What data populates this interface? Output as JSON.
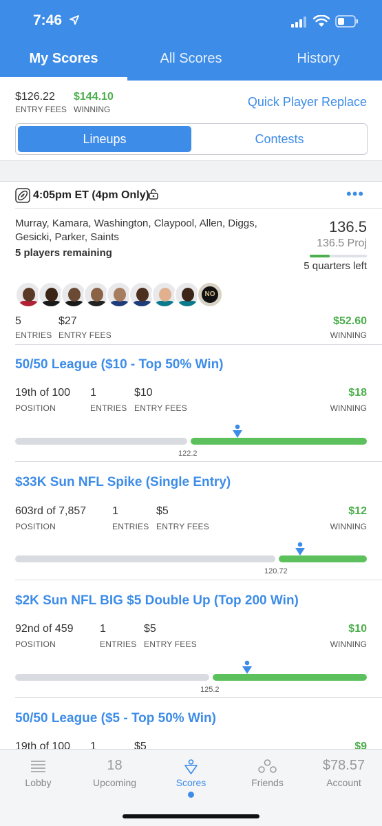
{
  "status": {
    "time": "7:46"
  },
  "tabs": [
    {
      "label": "My Scores",
      "active": true
    },
    {
      "label": "All Scores",
      "active": false
    },
    {
      "label": "History",
      "active": false
    }
  ],
  "summary": {
    "entry_fees_value": "$126.22",
    "entry_fees_label": "ENTRY FEES",
    "winning_value": "$144.10",
    "winning_label": "WINNING",
    "quick_replace": "Quick Player Replace"
  },
  "segment": {
    "lineups": "Lineups",
    "contests": "Contests"
  },
  "lineup": {
    "title": "4:05pm ET (4pm Only)",
    "players": "Murray, Kamara, Washington, Claypool, Allen, Diggs, Gesicki, Parker, Saints",
    "remaining": "5 players remaining",
    "points": "136.5",
    "projection": "136.5 Proj",
    "progress": 0.35,
    "quarters_left": "5 quarters left",
    "avatars": [
      {
        "name": "player-murray",
        "skin": "#5a3a26",
        "jersey": "#b22234"
      },
      {
        "name": "player-kamara",
        "skin": "#3b2416",
        "jersey": "#1a1a1a"
      },
      {
        "name": "player-washington",
        "skin": "#6b4a35",
        "jersey": "#1a1a1a"
      },
      {
        "name": "player-claypool",
        "skin": "#8a6246",
        "jersey": "#222"
      },
      {
        "name": "player-allen",
        "skin": "#a77d5f",
        "jersey": "#1f3b7a"
      },
      {
        "name": "player-diggs",
        "skin": "#4c2f1f",
        "jersey": "#1f3b7a"
      },
      {
        "name": "player-gesicki",
        "skin": "#e0b08f",
        "jersey": "#0a7a8c"
      },
      {
        "name": "player-parker",
        "skin": "#3a2518",
        "jersey": "#0a7a8c"
      }
    ],
    "dst_label": "NO",
    "entries_value": "5",
    "entries_label": "ENTRIES",
    "fees_value": "$27",
    "fees_label": "ENTRY FEES",
    "winning_value": "$52.60",
    "winning_label": "WINNING"
  },
  "contests": [
    {
      "title": "50/50 League ($10 - Top 50% Win)",
      "position": "19th of 100",
      "position_label": "POSITION",
      "entries": "1",
      "entries_label": "ENTRIES",
      "fee": "$10",
      "fee_label": "ENTRY FEES",
      "winning": "$18",
      "winning_label": "WINNING",
      "cutline": "122.2"
    },
    {
      "title": "$33K Sun NFL Spike (Single Entry)",
      "position": "603rd of 7,857",
      "position_label": "POSITION",
      "entries": "1",
      "entries_label": "ENTRIES",
      "fee": "$5",
      "fee_label": "ENTRY FEES",
      "winning": "$12",
      "winning_label": "WINNING",
      "cutline": "120.72"
    },
    {
      "title": "$2K Sun NFL BIG $5 Double Up (Top 200 Win)",
      "position": "92nd of 459",
      "position_label": "POSITION",
      "entries": "1",
      "entries_label": "ENTRIES",
      "fee": "$5",
      "fee_label": "ENTRY FEES",
      "winning": "$10",
      "winning_label": "WINNING",
      "cutline": "125.2"
    },
    {
      "title": "50/50 League ($5 - Top 50% Win)",
      "position": "19th of 100",
      "entries": "1",
      "fee": "$5",
      "winning": "$9"
    }
  ],
  "tabbar": {
    "lobby": "Lobby",
    "upcoming_count": "18",
    "upcoming": "Upcoming",
    "scores": "Scores",
    "friends": "Friends",
    "balance": "$78.57",
    "account": "Account"
  },
  "colors": {
    "brand": "#3d8ce8",
    "win": "#4cae4c"
  }
}
